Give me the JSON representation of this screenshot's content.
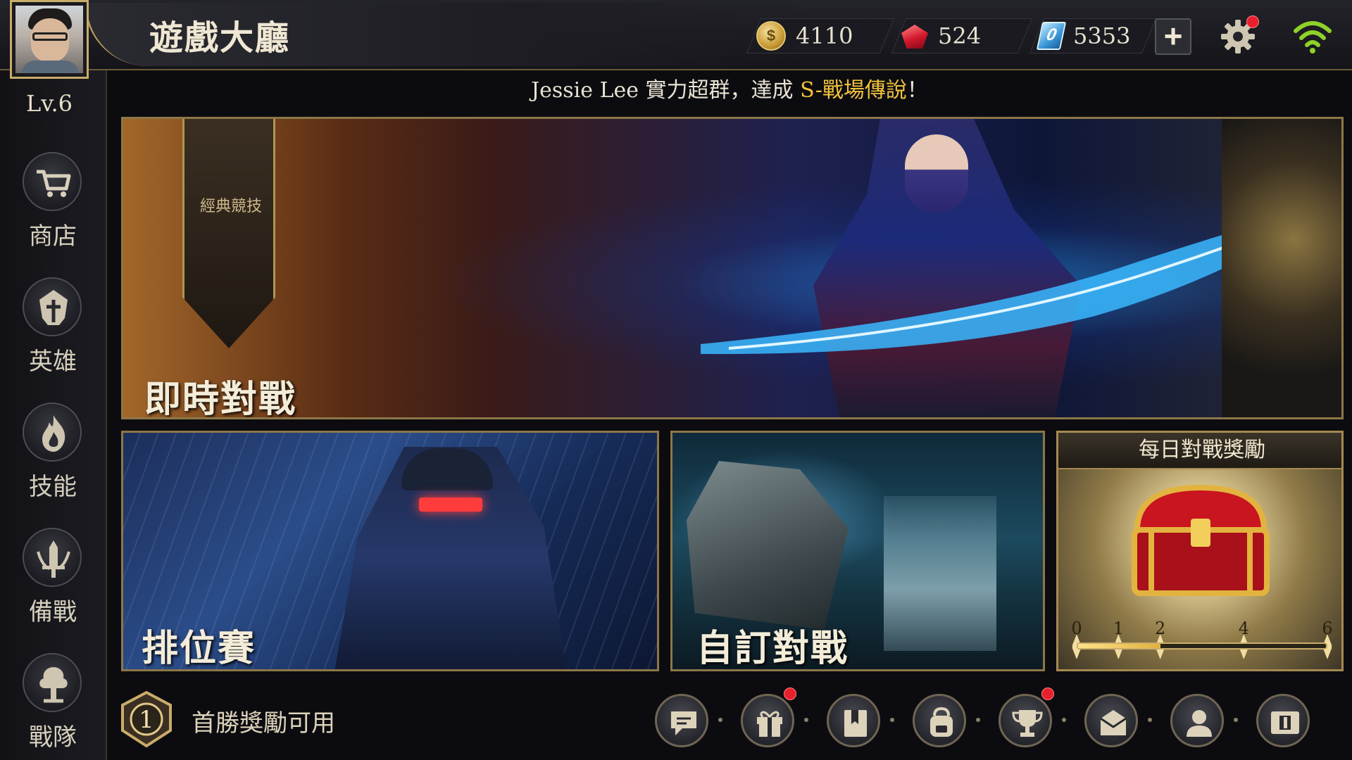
{
  "header": {
    "title": "遊戲大廳",
    "currencies": [
      {
        "name": "gold-coin",
        "icon": "coin-icon",
        "value": "4110"
      },
      {
        "name": "ruby",
        "icon": "gem-icon",
        "value": "524"
      },
      {
        "name": "voucher",
        "icon": "voucher-icon",
        "icon_text": "0",
        "value": "5353"
      }
    ],
    "add_label": "+",
    "coin_symbol": "$"
  },
  "player": {
    "level": "Lv.6"
  },
  "announcement": {
    "prefix": "Jessie Lee 實力超群，達成 ",
    "highlight": "S-戰場傳說",
    "suffix": "！"
  },
  "sidebar": {
    "items": [
      {
        "label": "商店",
        "icon": "shop-cart-icon"
      },
      {
        "label": "英雄",
        "icon": "hero-helmet-icon"
      },
      {
        "label": "技能",
        "icon": "skill-flame-icon"
      },
      {
        "label": "備戰",
        "icon": "prepare-sword-icon"
      },
      {
        "label": "戰隊",
        "icon": "team-tree-icon"
      }
    ]
  },
  "modes": {
    "realtime": {
      "label": "即時對戰",
      "banner": "經典競技"
    },
    "ranked": {
      "label": "排位賽"
    },
    "custom": {
      "label": "自訂對戰"
    }
  },
  "daily_reward": {
    "title": "每日對戰獎勵",
    "ticks": [
      "0",
      "1",
      "2",
      "4",
      "6"
    ],
    "progress_fraction": 0.333
  },
  "footer": {
    "first_win_rank": "1",
    "first_win_text": "首勝獎勵可用",
    "buttons": [
      {
        "icon": "chat-icon",
        "badge": false
      },
      {
        "icon": "gift-icon",
        "badge": true
      },
      {
        "icon": "book-icon",
        "badge": false
      },
      {
        "icon": "backpack-icon",
        "badge": false
      },
      {
        "icon": "trophy-icon",
        "badge": true
      },
      {
        "icon": "mail-icon",
        "badge": false
      },
      {
        "icon": "friends-icon",
        "badge": false
      },
      {
        "icon": "ranking-icon",
        "badge": false
      }
    ]
  },
  "colors": {
    "accent_gold": "#c9ac6a",
    "highlight_yellow": "#f2c33c",
    "badge_red": "#e8202d",
    "wifi_green": "#8fd12a"
  }
}
